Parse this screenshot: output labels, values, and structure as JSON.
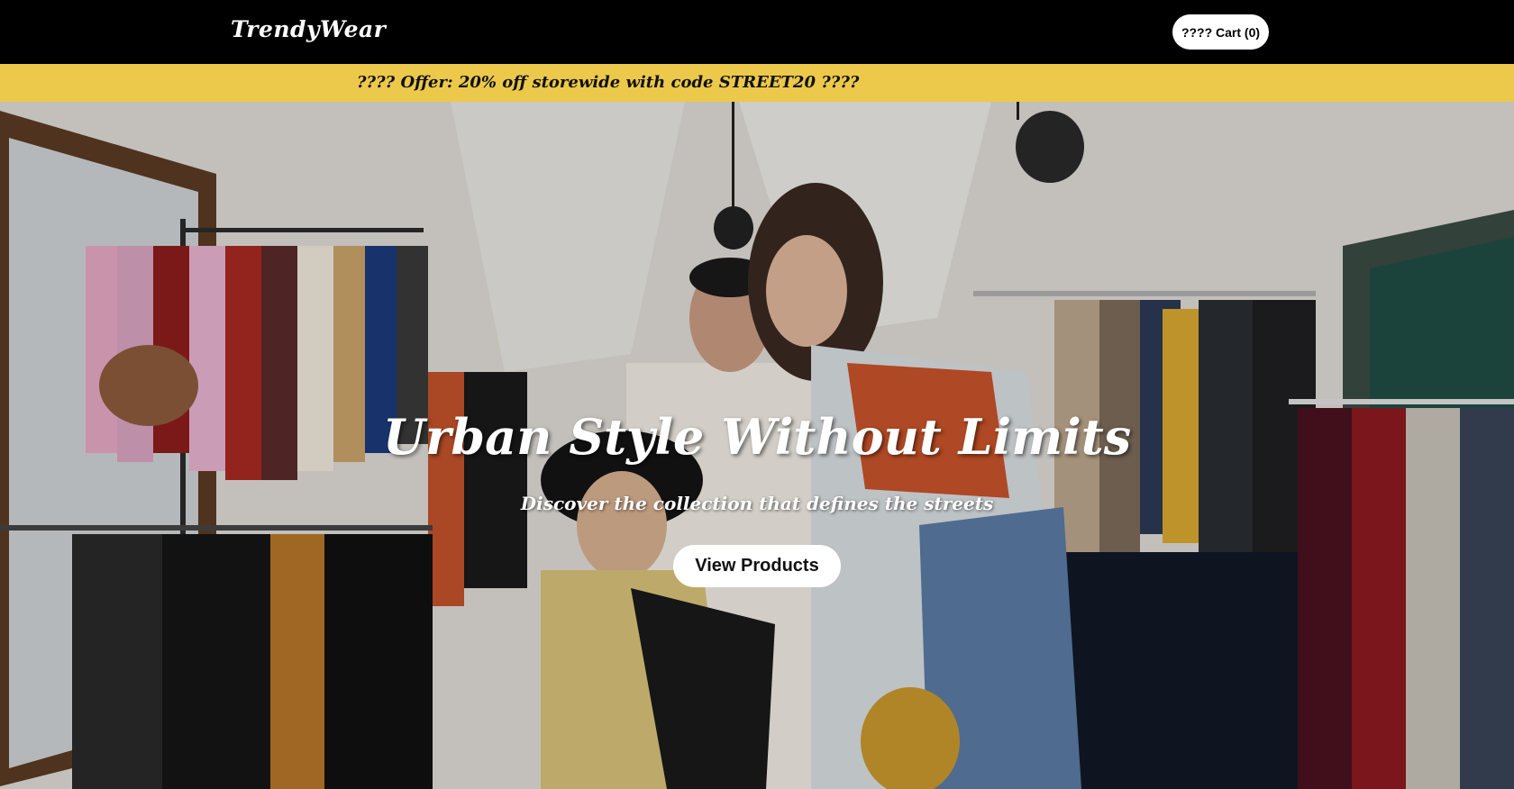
{
  "header": {
    "logo": "TrendyWear",
    "cart_label": "???? Cart (0)"
  },
  "offer": {
    "text": "???? Offer: 20% off storewide with code STREET20 ????"
  },
  "hero": {
    "title": "Urban Style Without Limits",
    "subtitle": "Discover the collection that defines the streets",
    "cta_label": "View Products"
  },
  "colors": {
    "topbar": "#000000",
    "offer_banner": "#ecc94b",
    "button_bg": "#ffffff"
  }
}
